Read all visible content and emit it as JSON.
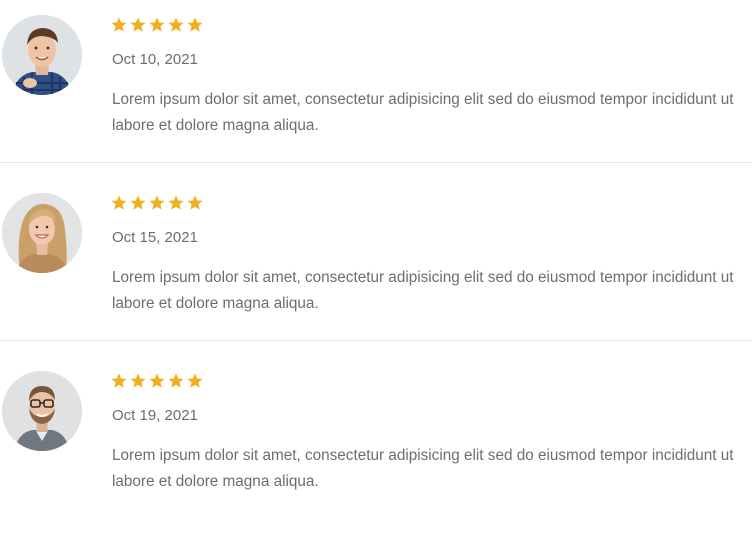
{
  "colors": {
    "star": "#f2b01e",
    "text": "#6d6d6d",
    "divider": "#e6e6e6"
  },
  "reviews": [
    {
      "avatar_icon": "avatar-man-plaid-shirt",
      "rating": 5,
      "date": "Oct 10, 2021",
      "text": "Lorem ipsum dolor sit amet, consectetur adipisicing elit sed do eiusmod tempor incididunt ut labore et dolore magna aliqua."
    },
    {
      "avatar_icon": "avatar-woman-blonde",
      "rating": 5,
      "date": "Oct 15, 2021",
      "text": "Lorem ipsum dolor sit amet, consectetur adipisicing elit sed do eiusmod tempor incididunt ut labore et dolore magna aliqua."
    },
    {
      "avatar_icon": "avatar-man-glasses",
      "rating": 5,
      "date": "Oct 19, 2021",
      "text": "Lorem ipsum dolor sit amet, consectetur adipisicing elit sed do eiusmod tempor incididunt ut labore et dolore magna aliqua."
    }
  ]
}
